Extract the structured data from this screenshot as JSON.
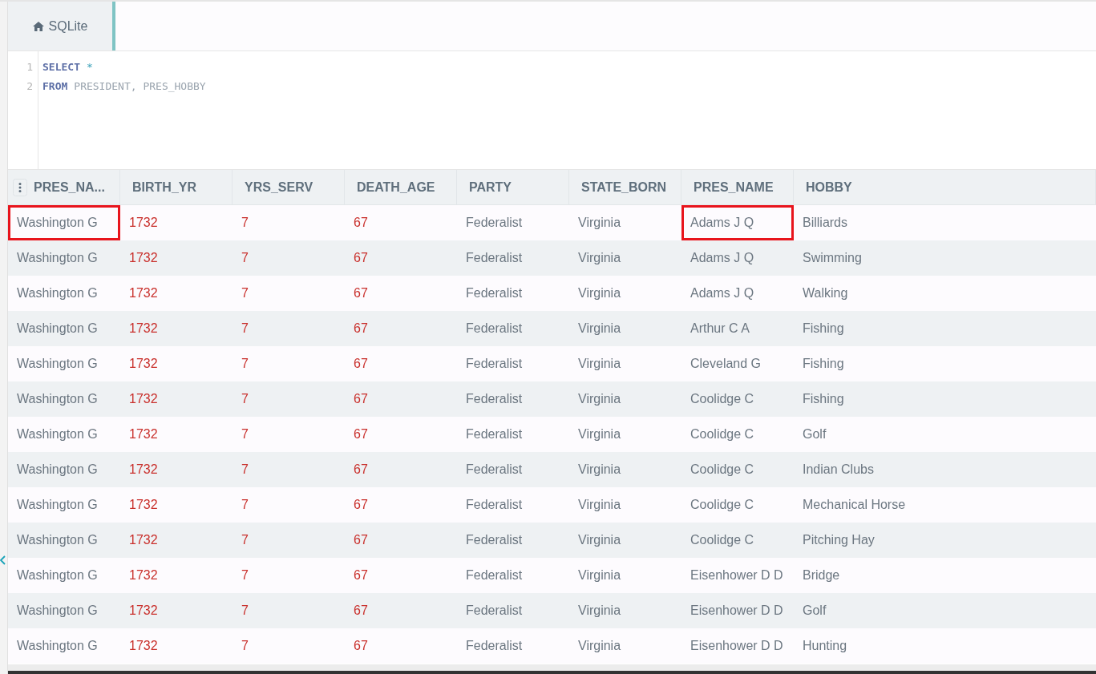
{
  "tabs": [
    {
      "label": "SQLite",
      "selected": true
    }
  ],
  "editor": {
    "lines": [
      {
        "number": "1",
        "tokens": [
          {
            "kind": "keyword",
            "text": "SELECT"
          },
          {
            "kind": "operator",
            "text": "*"
          }
        ]
      },
      {
        "number": "2",
        "tokens": [
          {
            "kind": "keyword",
            "text": "FROM"
          },
          {
            "kind": "plain",
            "text": "PRESIDENT, PRES_HOBBY"
          }
        ]
      }
    ]
  },
  "table": {
    "columns": [
      {
        "label": "PRES_NA...",
        "kind": "text"
      },
      {
        "label": "BIRTH_YR",
        "kind": "number"
      },
      {
        "label": "YRS_SERV",
        "kind": "number"
      },
      {
        "label": "DEATH_AGE",
        "kind": "number"
      },
      {
        "label": "PARTY",
        "kind": "text"
      },
      {
        "label": "STATE_BORN",
        "kind": "text"
      },
      {
        "label": "PRES_NAME",
        "kind": "text"
      },
      {
        "label": "HOBBY",
        "kind": "text"
      }
    ],
    "rows": [
      {
        "cells": [
          "Washington G",
          "1732",
          "7",
          "67",
          "Federalist",
          "Virginia",
          "Adams J Q",
          "Billiards"
        ],
        "highlighted": [
          true,
          false,
          false,
          false,
          false,
          false,
          true,
          false
        ]
      },
      {
        "cells": [
          "Washington G",
          "1732",
          "7",
          "67",
          "Federalist",
          "Virginia",
          "Adams J Q",
          "Swimming"
        ],
        "highlighted": [
          false,
          false,
          false,
          false,
          false,
          false,
          false,
          false
        ]
      },
      {
        "cells": [
          "Washington G",
          "1732",
          "7",
          "67",
          "Federalist",
          "Virginia",
          "Adams J Q",
          "Walking"
        ],
        "highlighted": [
          false,
          false,
          false,
          false,
          false,
          false,
          false,
          false
        ]
      },
      {
        "cells": [
          "Washington G",
          "1732",
          "7",
          "67",
          "Federalist",
          "Virginia",
          "Arthur C A",
          "Fishing"
        ],
        "highlighted": [
          false,
          false,
          false,
          false,
          false,
          false,
          false,
          false
        ]
      },
      {
        "cells": [
          "Washington G",
          "1732",
          "7",
          "67",
          "Federalist",
          "Virginia",
          "Cleveland G",
          "Fishing"
        ],
        "highlighted": [
          false,
          false,
          false,
          false,
          false,
          false,
          false,
          false
        ]
      },
      {
        "cells": [
          "Washington G",
          "1732",
          "7",
          "67",
          "Federalist",
          "Virginia",
          "Coolidge C",
          "Fishing"
        ],
        "highlighted": [
          false,
          false,
          false,
          false,
          false,
          false,
          false,
          false
        ]
      },
      {
        "cells": [
          "Washington G",
          "1732",
          "7",
          "67",
          "Federalist",
          "Virginia",
          "Coolidge C",
          "Golf"
        ],
        "highlighted": [
          false,
          false,
          false,
          false,
          false,
          false,
          false,
          false
        ]
      },
      {
        "cells": [
          "Washington G",
          "1732",
          "7",
          "67",
          "Federalist",
          "Virginia",
          "Coolidge C",
          "Indian Clubs"
        ],
        "highlighted": [
          false,
          false,
          false,
          false,
          false,
          false,
          false,
          false
        ]
      },
      {
        "cells": [
          "Washington G",
          "1732",
          "7",
          "67",
          "Federalist",
          "Virginia",
          "Coolidge C",
          "Mechanical Horse"
        ],
        "highlighted": [
          false,
          false,
          false,
          false,
          false,
          false,
          false,
          false
        ]
      },
      {
        "cells": [
          "Washington G",
          "1732",
          "7",
          "67",
          "Federalist",
          "Virginia",
          "Coolidge C",
          "Pitching Hay"
        ],
        "highlighted": [
          false,
          false,
          false,
          false,
          false,
          false,
          false,
          false
        ]
      },
      {
        "cells": [
          "Washington G",
          "1732",
          "7",
          "67",
          "Federalist",
          "Virginia",
          "Eisenhower D D",
          "Bridge"
        ],
        "highlighted": [
          false,
          false,
          false,
          false,
          false,
          false,
          false,
          false
        ]
      },
      {
        "cells": [
          "Washington G",
          "1732",
          "7",
          "67",
          "Federalist",
          "Virginia",
          "Eisenhower D D",
          "Golf"
        ],
        "highlighted": [
          false,
          false,
          false,
          false,
          false,
          false,
          false,
          false
        ]
      },
      {
        "cells": [
          "Washington G",
          "1732",
          "7",
          "67",
          "Federalist",
          "Virginia",
          "Eisenhower D D",
          "Hunting"
        ],
        "highlighted": [
          false,
          false,
          false,
          false,
          false,
          false,
          false,
          false
        ]
      }
    ]
  }
}
